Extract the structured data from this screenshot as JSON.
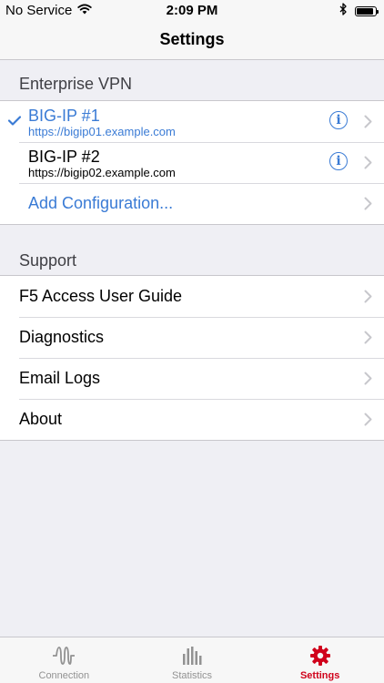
{
  "status_bar": {
    "carrier": "No Service",
    "time": "2:09 PM",
    "wifi_icon": "wifi-icon",
    "bluetooth_icon": "bluetooth-icon",
    "battery_icon": "battery-icon",
    "battery_level": 0.9
  },
  "nav": {
    "title": "Settings"
  },
  "enterprise_vpn": {
    "header": "Enterprise VPN",
    "items": [
      {
        "title": "BIG-IP #1",
        "url": "https://bigip01.example.com",
        "selected": true
      },
      {
        "title": "BIG-IP #2",
        "url": "https://bigip02.example.com",
        "selected": false
      }
    ],
    "add_label": "Add Configuration..."
  },
  "support": {
    "header": "Support",
    "items": [
      {
        "label": "F5 Access User Guide"
      },
      {
        "label": "Diagnostics"
      },
      {
        "label": "Email Logs"
      },
      {
        "label": "About"
      }
    ]
  },
  "tabbar": {
    "tabs": [
      {
        "label": "Connection",
        "icon": "connection-wave-icon",
        "active": false
      },
      {
        "label": "Statistics",
        "icon": "statistics-bars-icon",
        "active": false
      },
      {
        "label": "Settings",
        "icon": "gear-icon",
        "active": true
      }
    ]
  },
  "colors": {
    "accent": "#3a7bd5",
    "active_tab": "#d0021b",
    "background": "#efeff4",
    "inactive_tab": "#929292"
  }
}
